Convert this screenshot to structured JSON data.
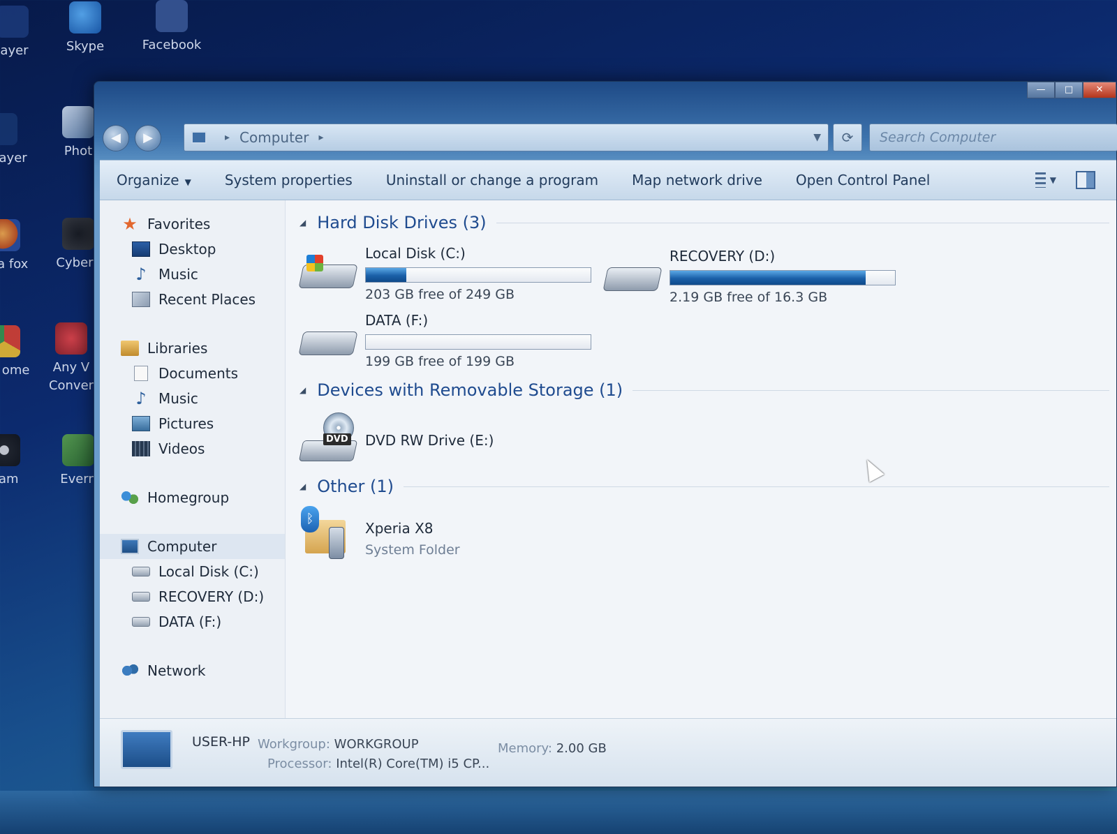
{
  "desktop": {
    "icons": [
      {
        "label": "layer",
        "icon": "player-icon"
      },
      {
        "label": "Skype",
        "icon": "skype-icon"
      },
      {
        "label": "Facebook",
        "icon": "facebook-icon"
      },
      {
        "label": "Phot",
        "icon": "photo-icon"
      },
      {
        "label": "zilla fox",
        "icon": "firefox-icon"
      },
      {
        "label": "CyberL",
        "icon": "cyberlink-icon"
      },
      {
        "label": "gle ome",
        "icon": "chrome-icon"
      },
      {
        "label": "Any V Conver",
        "icon": "any-video-converter-icon"
      },
      {
        "label": "Cam",
        "icon": "camera-icon"
      },
      {
        "label": "Evern",
        "icon": "evernote-icon"
      }
    ],
    "side_labels": {
      "left_top": "ne layer"
    }
  },
  "window": {
    "caption_buttons": {
      "minimize": "—",
      "maximize": "□",
      "close": "✕"
    },
    "address": {
      "segments": [
        "Computer"
      ],
      "separator": "▸"
    },
    "refresh_glyph": "⟳",
    "search_placeholder": "Search Computer",
    "nav_back_glyph": "◀",
    "nav_forward_glyph": "▶"
  },
  "toolbar": {
    "organize": "Organize",
    "dropdown_glyph": "▼",
    "items": [
      "System properties",
      "Uninstall or change a program",
      "Map network drive",
      "Open Control Panel"
    ]
  },
  "sidebar": {
    "favorites": {
      "label": "Favorites",
      "items": [
        "Desktop",
        "Music",
        "Recent Places"
      ]
    },
    "libraries": {
      "label": "Libraries",
      "items": [
        "Documents",
        "Music",
        "Pictures",
        "Videos"
      ]
    },
    "homegroup": "Homegroup",
    "computer": {
      "label": "Computer",
      "items": [
        "Local Disk (C:)",
        "RECOVERY (D:)",
        "DATA (F:)"
      ]
    },
    "network": "Network",
    "star_glyph": "★",
    "note_glyph": "♪"
  },
  "main": {
    "collapse_glyph": "◢",
    "groups": {
      "hdd": "Hard Disk Drives (3)",
      "removable": "Devices with Removable Storage (1)",
      "other": "Other (1)"
    },
    "drives": [
      {
        "name": "Local Disk (C:)",
        "detail": "203 GB free of 249 GB",
        "used_fraction": 0.18
      },
      {
        "name": "RECOVERY (D:)",
        "detail": "2.19 GB free of 16.3 GB",
        "used_fraction": 0.87
      },
      {
        "name": "DATA (F:)",
        "detail": "199 GB free of 199 GB",
        "used_fraction": 0.0
      }
    ],
    "dvd": {
      "name": "DVD RW Drive (E:)",
      "badge": "DVD"
    },
    "other_item": {
      "name": "Xperia X8",
      "sub": "System Folder",
      "bt_glyph": "ᛒ"
    }
  },
  "details": {
    "pc_name": "USER-HP",
    "workgroup_label": "Workgroup:",
    "workgroup": "WORKGROUP",
    "memory_label": "Memory:",
    "memory": "2.00 GB",
    "processor_label": "Processor:",
    "processor": "Intel(R) Core(TM) i5 CP..."
  }
}
